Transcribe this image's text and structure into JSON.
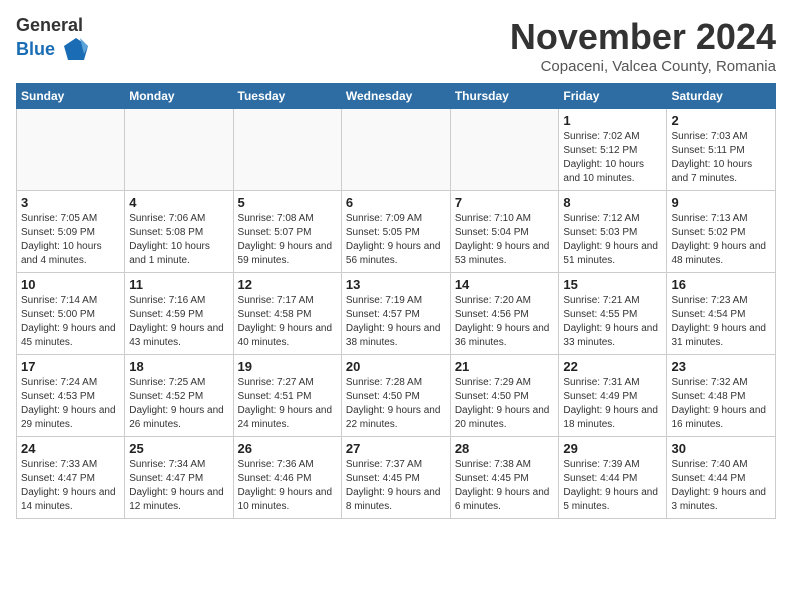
{
  "header": {
    "logo_general": "General",
    "logo_blue": "Blue",
    "title": "November 2024",
    "subtitle": "Copaceni, Valcea County, Romania"
  },
  "weekdays": [
    "Sunday",
    "Monday",
    "Tuesday",
    "Wednesday",
    "Thursday",
    "Friday",
    "Saturday"
  ],
  "weeks": [
    [
      {
        "day": "",
        "info": ""
      },
      {
        "day": "",
        "info": ""
      },
      {
        "day": "",
        "info": ""
      },
      {
        "day": "",
        "info": ""
      },
      {
        "day": "",
        "info": ""
      },
      {
        "day": "1",
        "info": "Sunrise: 7:02 AM\nSunset: 5:12 PM\nDaylight: 10 hours and 10 minutes."
      },
      {
        "day": "2",
        "info": "Sunrise: 7:03 AM\nSunset: 5:11 PM\nDaylight: 10 hours and 7 minutes."
      }
    ],
    [
      {
        "day": "3",
        "info": "Sunrise: 7:05 AM\nSunset: 5:09 PM\nDaylight: 10 hours and 4 minutes."
      },
      {
        "day": "4",
        "info": "Sunrise: 7:06 AM\nSunset: 5:08 PM\nDaylight: 10 hours and 1 minute."
      },
      {
        "day": "5",
        "info": "Sunrise: 7:08 AM\nSunset: 5:07 PM\nDaylight: 9 hours and 59 minutes."
      },
      {
        "day": "6",
        "info": "Sunrise: 7:09 AM\nSunset: 5:05 PM\nDaylight: 9 hours and 56 minutes."
      },
      {
        "day": "7",
        "info": "Sunrise: 7:10 AM\nSunset: 5:04 PM\nDaylight: 9 hours and 53 minutes."
      },
      {
        "day": "8",
        "info": "Sunrise: 7:12 AM\nSunset: 5:03 PM\nDaylight: 9 hours and 51 minutes."
      },
      {
        "day": "9",
        "info": "Sunrise: 7:13 AM\nSunset: 5:02 PM\nDaylight: 9 hours and 48 minutes."
      }
    ],
    [
      {
        "day": "10",
        "info": "Sunrise: 7:14 AM\nSunset: 5:00 PM\nDaylight: 9 hours and 45 minutes."
      },
      {
        "day": "11",
        "info": "Sunrise: 7:16 AM\nSunset: 4:59 PM\nDaylight: 9 hours and 43 minutes."
      },
      {
        "day": "12",
        "info": "Sunrise: 7:17 AM\nSunset: 4:58 PM\nDaylight: 9 hours and 40 minutes."
      },
      {
        "day": "13",
        "info": "Sunrise: 7:19 AM\nSunset: 4:57 PM\nDaylight: 9 hours and 38 minutes."
      },
      {
        "day": "14",
        "info": "Sunrise: 7:20 AM\nSunset: 4:56 PM\nDaylight: 9 hours and 36 minutes."
      },
      {
        "day": "15",
        "info": "Sunrise: 7:21 AM\nSunset: 4:55 PM\nDaylight: 9 hours and 33 minutes."
      },
      {
        "day": "16",
        "info": "Sunrise: 7:23 AM\nSunset: 4:54 PM\nDaylight: 9 hours and 31 minutes."
      }
    ],
    [
      {
        "day": "17",
        "info": "Sunrise: 7:24 AM\nSunset: 4:53 PM\nDaylight: 9 hours and 29 minutes."
      },
      {
        "day": "18",
        "info": "Sunrise: 7:25 AM\nSunset: 4:52 PM\nDaylight: 9 hours and 26 minutes."
      },
      {
        "day": "19",
        "info": "Sunrise: 7:27 AM\nSunset: 4:51 PM\nDaylight: 9 hours and 24 minutes."
      },
      {
        "day": "20",
        "info": "Sunrise: 7:28 AM\nSunset: 4:50 PM\nDaylight: 9 hours and 22 minutes."
      },
      {
        "day": "21",
        "info": "Sunrise: 7:29 AM\nSunset: 4:50 PM\nDaylight: 9 hours and 20 minutes."
      },
      {
        "day": "22",
        "info": "Sunrise: 7:31 AM\nSunset: 4:49 PM\nDaylight: 9 hours and 18 minutes."
      },
      {
        "day": "23",
        "info": "Sunrise: 7:32 AM\nSunset: 4:48 PM\nDaylight: 9 hours and 16 minutes."
      }
    ],
    [
      {
        "day": "24",
        "info": "Sunrise: 7:33 AM\nSunset: 4:47 PM\nDaylight: 9 hours and 14 minutes."
      },
      {
        "day": "25",
        "info": "Sunrise: 7:34 AM\nSunset: 4:47 PM\nDaylight: 9 hours and 12 minutes."
      },
      {
        "day": "26",
        "info": "Sunrise: 7:36 AM\nSunset: 4:46 PM\nDaylight: 9 hours and 10 minutes."
      },
      {
        "day": "27",
        "info": "Sunrise: 7:37 AM\nSunset: 4:45 PM\nDaylight: 9 hours and 8 minutes."
      },
      {
        "day": "28",
        "info": "Sunrise: 7:38 AM\nSunset: 4:45 PM\nDaylight: 9 hours and 6 minutes."
      },
      {
        "day": "29",
        "info": "Sunrise: 7:39 AM\nSunset: 4:44 PM\nDaylight: 9 hours and 5 minutes."
      },
      {
        "day": "30",
        "info": "Sunrise: 7:40 AM\nSunset: 4:44 PM\nDaylight: 9 hours and 3 minutes."
      }
    ]
  ]
}
